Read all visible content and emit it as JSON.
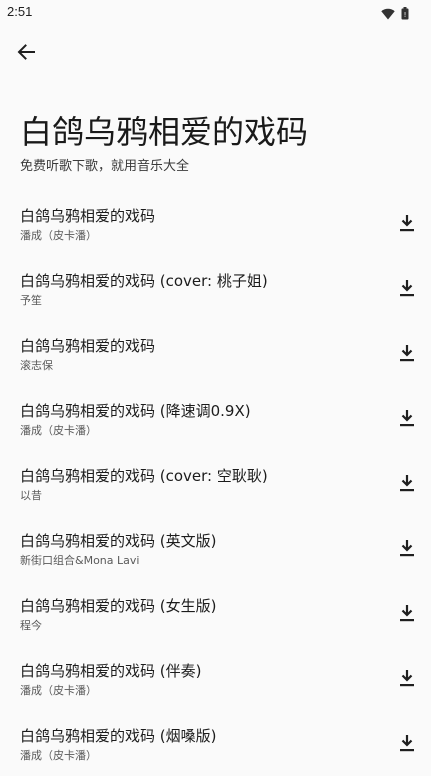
{
  "status_bar": {
    "time": "2:51",
    "icons": [
      "wifi-icon",
      "battery-icon"
    ]
  },
  "header": {
    "back_icon": "back-arrow-icon",
    "title": "白鸽乌鸦相爱的戏码",
    "subtitle": "免费听歌下歌，就用音乐大全"
  },
  "songs": [
    {
      "title": "白鸽乌鸦相爱的戏码",
      "artist": "潘成（皮卡潘）"
    },
    {
      "title": "白鸽乌鸦相爱的戏码 (cover: 桃子姐)",
      "artist": "予笙"
    },
    {
      "title": "白鸽乌鸦相爱的戏码",
      "artist": "滚志保"
    },
    {
      "title": "白鸽乌鸦相爱的戏码 (降速调0.9X)",
      "artist": "潘成（皮卡潘）"
    },
    {
      "title": "白鸽乌鸦相爱的戏码 (cover: 空耿耿)",
      "artist": "以昔"
    },
    {
      "title": "白鸽乌鸦相爱的戏码 (英文版)",
      "artist": "新街口组合&Mona Lavi"
    },
    {
      "title": "白鸽乌鸦相爱的戏码 (女生版)",
      "artist": "程今"
    },
    {
      "title": "白鸽乌鸦相爱的戏码 (伴奏)",
      "artist": "潘成（皮卡潘）"
    },
    {
      "title": "白鸽乌鸦相爱的戏码 (烟嗓版)",
      "artist": "潘成（皮卡潘）"
    }
  ],
  "download_icon": "download-icon",
  "colors": {
    "background": "#fafafa",
    "text_primary": "#1c1c1c",
    "text_secondary": "#5a5a5a",
    "icon": "#1f1f1f"
  }
}
